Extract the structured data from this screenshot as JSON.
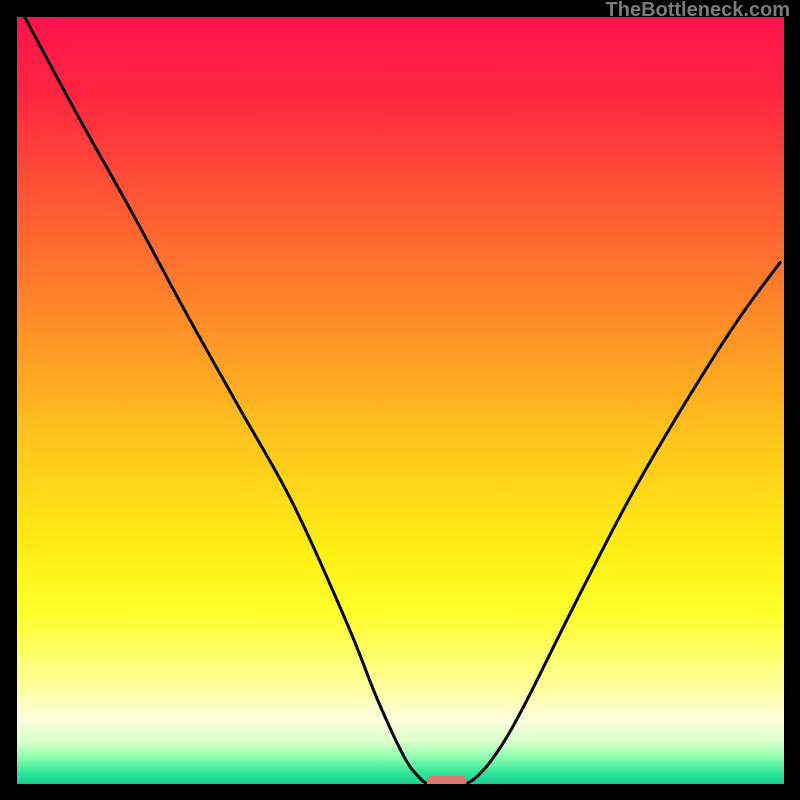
{
  "watermark": "TheBottleneck.com",
  "chart_data": {
    "type": "line",
    "title": "",
    "xlabel": "",
    "ylabel": "",
    "xlim": [
      0,
      100
    ],
    "ylim": [
      0,
      100
    ],
    "grid": false,
    "background_gradient": {
      "stops": [
        {
          "pos": 0.0,
          "color": "#ff124c"
        },
        {
          "pos": 0.1,
          "color": "#ff2541"
        },
        {
          "pos": 0.25,
          "color": "#ff5b34"
        },
        {
          "pos": 0.4,
          "color": "#ff8e28"
        },
        {
          "pos": 0.55,
          "color": "#ffc41d"
        },
        {
          "pos": 0.7,
          "color": "#fff014"
        },
        {
          "pos": 0.78,
          "color": "#ffff2e"
        },
        {
          "pos": 0.88,
          "color": "#ffffa5"
        },
        {
          "pos": 0.915,
          "color": "#ffffe0"
        },
        {
          "pos": 0.945,
          "color": "#d8ffc9"
        },
        {
          "pos": 0.965,
          "color": "#8cffae"
        },
        {
          "pos": 0.985,
          "color": "#34e79a"
        },
        {
          "pos": 1.0,
          "color": "#17cf8e"
        }
      ]
    },
    "series": [
      {
        "name": "bottleneck-curve-left",
        "x": [
          1.0,
          8.0,
          15.0,
          22.0,
          29.0,
          36.0,
          43.0,
          47.0,
          50.5,
          52.5,
          53.5
        ],
        "y": [
          100.0,
          87.0,
          74.5,
          61.5,
          49.0,
          36.5,
          21.0,
          11.0,
          3.5,
          0.8,
          0.0
        ]
      },
      {
        "name": "bottleneck-curve-right",
        "x": [
          58.5,
          60.0,
          62.5,
          66.0,
          73.0,
          80.0,
          87.0,
          94.0,
          99.5
        ],
        "y": [
          0.0,
          1.0,
          4.0,
          10.0,
          24.0,
          37.5,
          49.5,
          60.5,
          68.0
        ]
      }
    ],
    "marker": {
      "name": "optimal-marker",
      "x_center": 56.0,
      "x_halfwidth": 2.6,
      "y": 0.0,
      "color": "#d97772"
    }
  }
}
